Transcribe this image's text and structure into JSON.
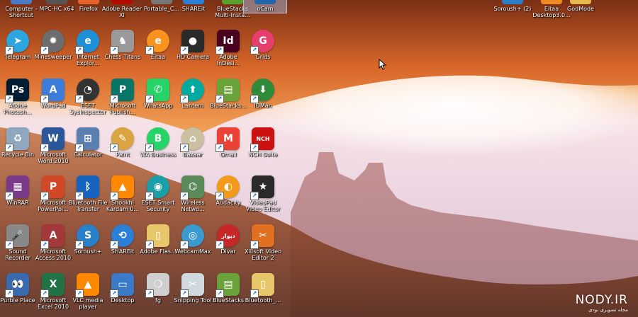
{
  "top_row": [
    {
      "name": "computer-shortcut",
      "label": "Computer - Shortcut",
      "color": "#4a7bc8"
    },
    {
      "name": "mpc-hc",
      "label": "MPC-HC x64",
      "color": "#555555"
    },
    {
      "name": "firefox",
      "label": "Firefox",
      "color": "#e8622c"
    },
    {
      "name": "adobe-reader",
      "label": "Adobe Reader XI",
      "color": "#b30b00"
    },
    {
      "name": "portable",
      "label": "Portable_C...",
      "color": "#777777"
    },
    {
      "name": "shareit-top",
      "label": "SHAREit",
      "color": "#2b7fd6"
    },
    {
      "name": "bluestacks-multi",
      "label": "BlueStacks Multi-Insta...",
      "color": "#5aa02c"
    },
    {
      "name": "ocam",
      "label": "oCam",
      "color": "#2266aa"
    },
    {
      "name": "soroush-2",
      "label": "Soroush+ (2)",
      "color": "#2a7fc9"
    },
    {
      "name": "eitaa-desktop",
      "label": "Eitaa Desktop3.0...",
      "color": "#f08a24"
    },
    {
      "name": "godmode",
      "label": "GodMode",
      "color": "#e6b84d"
    }
  ],
  "icons": [
    {
      "name": "telegram",
      "label": "Telegram",
      "glyph": "➤",
      "color": "#2ca5e0",
      "round": true
    },
    {
      "name": "minesweeper",
      "label": "Minesweeper",
      "glyph": "✹",
      "color": "#6d6d6d",
      "round": true
    },
    {
      "name": "internet-explorer",
      "label": "Internet Explor...",
      "glyph": "e",
      "color": "#1e90d8",
      "round": true
    },
    {
      "name": "chess-titans",
      "label": "Chess Titans",
      "glyph": "♞",
      "color": "#9a9a9a",
      "round": false
    },
    {
      "name": "eitaa",
      "label": "Eitaa",
      "glyph": "e",
      "color": "#f7931e",
      "round": true
    },
    {
      "name": "hd-camera",
      "label": "HD Camera",
      "glyph": "●",
      "color": "#2a2a2a",
      "round": false
    },
    {
      "name": "adobe-indesign",
      "label": "Adobe InDesi...",
      "glyph": "Id",
      "color": "#49021f",
      "round": false
    },
    {
      "name": "grids",
      "label": "Grids",
      "glyph": "G",
      "color": "#e63e6d",
      "round": true
    },
    {
      "name": "adobe-photoshop",
      "label": "Adobe Photosh...",
      "glyph": "Ps",
      "color": "#001d34",
      "round": false
    },
    {
      "name": "wordpad",
      "label": "WordPad",
      "glyph": "A",
      "color": "#3b7dd8",
      "round": false
    },
    {
      "name": "eset-sysinspector",
      "label": "ESET SysInspector",
      "glyph": "◔",
      "color": "#333333",
      "round": true
    },
    {
      "name": "microsoft-publisher",
      "label": "Microsoft Publish...",
      "glyph": "P",
      "color": "#077568",
      "round": false
    },
    {
      "name": "whatsapp",
      "label": "WhatsApp",
      "glyph": "✆",
      "color": "#25d366",
      "round": false
    },
    {
      "name": "lantern",
      "label": "Lantern",
      "glyph": "⬆",
      "color": "#00aaa0",
      "round": true
    },
    {
      "name": "bluestacks",
      "label": "BlueStacks...",
      "glyph": "▤",
      "color": "#6aa33a",
      "round": false
    },
    {
      "name": "idman",
      "label": "IDMan",
      "glyph": "⬇",
      "color": "#2e8b3a",
      "round": true
    },
    {
      "name": "recycle-bin",
      "label": "Recycle Bin",
      "glyph": "♻",
      "color": "#8fa8c0",
      "round": false
    },
    {
      "name": "microsoft-word-2010",
      "label": "Microsoft Word 2010",
      "glyph": "W",
      "color": "#2b579a",
      "round": false
    },
    {
      "name": "calculator",
      "label": "Calculator",
      "glyph": "⊞",
      "color": "#5a7fb0",
      "round": false
    },
    {
      "name": "paint",
      "label": "Paint",
      "glyph": "✎",
      "color": "#d9a441",
      "round": true
    },
    {
      "name": "wa-business",
      "label": "WA Business",
      "glyph": "B",
      "color": "#25d366",
      "round": true
    },
    {
      "name": "bazaar",
      "label": "Bazaar",
      "glyph": "⌂",
      "color": "#c8c0a0",
      "round": true
    },
    {
      "name": "gmail",
      "label": "Gmail",
      "glyph": "M",
      "color": "#ea4335",
      "round": false
    },
    {
      "name": "nch-suite",
      "label": "NCH Suite",
      "glyph": "NCH",
      "color": "#cc1111",
      "round": false
    },
    {
      "name": "winrar",
      "label": "WinRAR",
      "glyph": "▦",
      "color": "#7a3a8a",
      "round": false
    },
    {
      "name": "microsoft-powerpoint",
      "label": "Microsoft PowerPoi...",
      "glyph": "P",
      "color": "#d24726",
      "round": false
    },
    {
      "name": "bluetooth-file-transfer",
      "label": "Bluetooth File Transfer",
      "glyph": "ᛒ",
      "color": "#1565c0",
      "round": false
    },
    {
      "name": "shookhi-kardam",
      "label": "Shookhi Kardam 0...",
      "glyph": "▲",
      "color": "#ff8800",
      "round": false
    },
    {
      "name": "eset-smart-security",
      "label": "ESET Smart Security",
      "glyph": "◉",
      "color": "#1a9fa8",
      "round": true
    },
    {
      "name": "wireless-network",
      "label": "Wireless Netwo...",
      "glyph": "⌬",
      "color": "#5a8a5a",
      "round": false
    },
    {
      "name": "audacity",
      "label": "Audacity",
      "glyph": "◐",
      "color": "#f29a1a",
      "round": true
    },
    {
      "name": "videopad",
      "label": "VideoPad Video Editor",
      "glyph": "★",
      "color": "#2a2a2a",
      "round": false
    },
    {
      "name": "sound-recorder",
      "label": "Sound Recorder",
      "glyph": "🎤",
      "color": "#888888",
      "round": false
    },
    {
      "name": "microsoft-access-2010",
      "label": "Microsoft Access 2010",
      "glyph": "A",
      "color": "#a4373a",
      "round": false
    },
    {
      "name": "soroush",
      "label": "Soroush+",
      "glyph": "S",
      "color": "#2a7fc9",
      "round": true
    },
    {
      "name": "shareit",
      "label": "SHAREit",
      "glyph": "⟲",
      "color": "#2b7fd6",
      "round": true
    },
    {
      "name": "adobe-flash",
      "label": "Adobe Flas...",
      "glyph": "▯",
      "color": "#e8c66a",
      "round": false
    },
    {
      "name": "webcammax",
      "label": "WebcamMax",
      "glyph": "◎",
      "color": "#3a9ad0",
      "round": true
    },
    {
      "name": "divar",
      "label": "Divar",
      "glyph": "دیوار",
      "color": "#c62828",
      "round": true
    },
    {
      "name": "xilisoft-video-editor",
      "label": "Xilisoft Video Editor 2",
      "glyph": "✂",
      "color": "#e07020",
      "round": false
    },
    {
      "name": "purble-place",
      "label": "Purble Place",
      "glyph": "👀",
      "color": "#3a6ab0",
      "round": false
    },
    {
      "name": "microsoft-excel-2010",
      "label": "Microsoft Excel 2010",
      "glyph": "X",
      "color": "#217346",
      "round": false
    },
    {
      "name": "vlc-media-player",
      "label": "VLC media player",
      "glyph": "▲",
      "color": "#ff8800",
      "round": false
    },
    {
      "name": "desktop",
      "label": "Desktop",
      "glyph": "▭",
      "color": "#3a7ac8",
      "round": false
    },
    {
      "name": "fg",
      "label": "fg",
      "glyph": "❍",
      "color": "#cfcfcf",
      "round": false
    },
    {
      "name": "snipping-tool",
      "label": "Snipping Tool",
      "glyph": "✂",
      "color": "#d0d8e0",
      "round": false
    },
    {
      "name": "bluestacks-2",
      "label": "BlueStacks",
      "glyph": "▤",
      "color": "#6aa33a",
      "round": false
    },
    {
      "name": "bluetooth-folder",
      "label": "Bluetooth_...",
      "glyph": "▯",
      "color": "#e8c66a",
      "round": false
    }
  ],
  "watermark": {
    "site": "NODY.IR",
    "sub": "مجله تصویری نودی"
  }
}
